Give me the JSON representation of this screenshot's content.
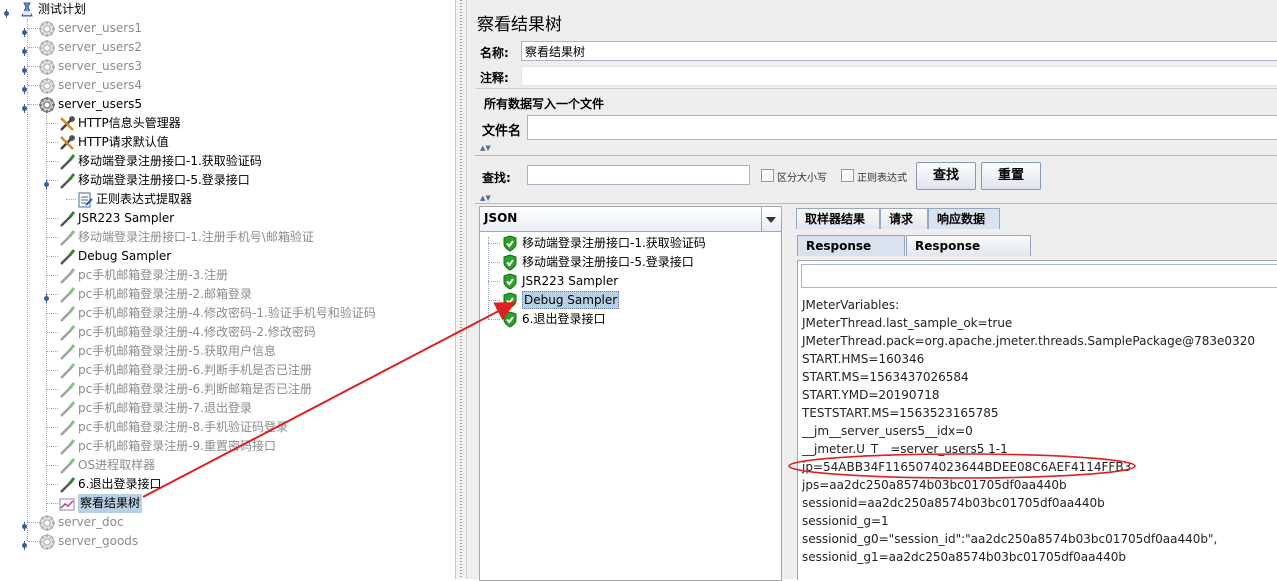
{
  "tree": {
    "items": [
      {
        "label": "测试计划",
        "kind": "plan",
        "depth": 0,
        "state": "normal"
      },
      {
        "label": "server_users1",
        "kind": "group",
        "depth": 1,
        "state": "disabled"
      },
      {
        "label": "server_users2",
        "kind": "group",
        "depth": 1,
        "state": "disabled"
      },
      {
        "label": "server_users3",
        "kind": "group",
        "depth": 1,
        "state": "disabled"
      },
      {
        "label": "server_users4",
        "kind": "group",
        "depth": 1,
        "state": "disabled"
      },
      {
        "label": "server_users5",
        "kind": "group",
        "depth": 1,
        "state": "normal"
      },
      {
        "label": "HTTP信息头管理器",
        "kind": "config",
        "depth": 2,
        "state": "normal"
      },
      {
        "label": "HTTP请求默认值",
        "kind": "config",
        "depth": 2,
        "state": "normal"
      },
      {
        "label": "移动端登录注册接口-1.获取验证码",
        "kind": "sampler",
        "depth": 2,
        "state": "normal"
      },
      {
        "label": "移动端登录注册接口-5.登录接口",
        "kind": "sampler",
        "depth": 2,
        "state": "normal"
      },
      {
        "label": "正则表达式提取器",
        "kind": "extractor",
        "depth": 3,
        "state": "normal"
      },
      {
        "label": "JSR223 Sampler",
        "kind": "sampler",
        "depth": 2,
        "state": "normal"
      },
      {
        "label": "移动端登录注册接口-1.注册手机号\\邮箱验证",
        "kind": "sampler",
        "depth": 2,
        "state": "disabled"
      },
      {
        "label": "Debug Sampler",
        "kind": "sampler",
        "depth": 2,
        "state": "normal"
      },
      {
        "label": "pc手机邮箱登录注册-3.注册",
        "kind": "sampler",
        "depth": 2,
        "state": "disabled"
      },
      {
        "label": "pc手机邮箱登录注册-2.邮箱登录",
        "kind": "sampler",
        "depth": 2,
        "state": "disabled"
      },
      {
        "label": "pc手机邮箱登录注册-4.修改密码-1.验证手机号和验证码",
        "kind": "sampler",
        "depth": 2,
        "state": "disabled"
      },
      {
        "label": "pc手机邮箱登录注册-4.修改密码-2.修改密码",
        "kind": "sampler",
        "depth": 2,
        "state": "disabled"
      },
      {
        "label": "pc手机邮箱登录注册-5.获取用户信息",
        "kind": "sampler",
        "depth": 2,
        "state": "disabled"
      },
      {
        "label": "pc手机邮箱登录注册-6.判断手机是否已注册",
        "kind": "sampler",
        "depth": 2,
        "state": "disabled"
      },
      {
        "label": "pc手机邮箱登录注册-6.判断邮箱是否已注册",
        "kind": "sampler",
        "depth": 2,
        "state": "disabled"
      },
      {
        "label": "pc手机邮箱登录注册-7.退出登录",
        "kind": "sampler",
        "depth": 2,
        "state": "disabled"
      },
      {
        "label": "pc手机邮箱登录注册-8.手机验证码登录",
        "kind": "sampler",
        "depth": 2,
        "state": "disabled"
      },
      {
        "label": "pc手机邮箱登录注册-9.重置密码接口",
        "kind": "sampler",
        "depth": 2,
        "state": "disabled"
      },
      {
        "label": "OS进程取样器",
        "kind": "sampler",
        "depth": 2,
        "state": "disabled"
      },
      {
        "label": "6.退出登录接口",
        "kind": "sampler",
        "depth": 2,
        "state": "normal"
      },
      {
        "label": "察看结果树",
        "kind": "listener",
        "depth": 2,
        "state": "selected"
      },
      {
        "label": "server_doc",
        "kind": "group",
        "depth": 1,
        "state": "disabled"
      },
      {
        "label": "server_goods",
        "kind": "group",
        "depth": 1,
        "state": "disabled"
      }
    ]
  },
  "panel": {
    "title": "察看结果树",
    "name_label": "名称:",
    "name_value": "察看结果树",
    "comment_label": "注释:",
    "comment_value": "",
    "file_section_title": "所有数据写入一个文件",
    "file_label": "文件名",
    "file_value": ""
  },
  "search": {
    "label": "查找:",
    "value": "",
    "case_label": "区分大小写",
    "regex_label": "正则表达式",
    "find_button": "查找",
    "reset_button": "重置"
  },
  "results": {
    "renderer": "JSON",
    "items": [
      {
        "label": "移动端登录注册接口-1.获取验证码",
        "status": "success"
      },
      {
        "label": "移动端登录注册接口-5.登录接口",
        "status": "success"
      },
      {
        "label": "JSR223 Sampler",
        "status": "success"
      },
      {
        "label": "Debug Sampler",
        "status": "success",
        "selected": true
      },
      {
        "label": "6.退出登录接口",
        "status": "success"
      }
    ]
  },
  "tabs": {
    "main": [
      "取样器结果",
      "请求",
      "响应数据"
    ],
    "main_active": 2,
    "sub": [
      "Response Body",
      "Response headers"
    ],
    "sub_active": 0
  },
  "response": {
    "lines": [
      "JMeterVariables:",
      "JMeterThread.last_sample_ok=true",
      "JMeterThread.pack=org.apache.jmeter.threads.SamplePackage@783e0320",
      "START.HMS=160346",
      "START.MS=1563437026584",
      "START.YMD=20190718",
      "TESTSTART.MS=1563523165785",
      "__jm__server_users5__idx=0",
      "__jmeter.U_T__=server_users5 1-1",
      "jp=54ABB34F1165074023644BDEE08C6AEF4114FFB3",
      "jps=aa2dc250a8574b03bc01705df0aa440b",
      "sessionid=aa2dc250a8574b03bc01705df0aa440b",
      "sessionid_g=1",
      "sessionid_g0=\"session_id\":\"aa2dc250a8574b03bc01705df0aa440b\",",
      "sessionid_g1=aa2dc250a8574b03bc01705df0aa440b"
    ],
    "highlighted_line": 9
  },
  "colors": {
    "annotation": "#e02020",
    "selection": "#b8cfe5",
    "success": "#2aa12a"
  }
}
